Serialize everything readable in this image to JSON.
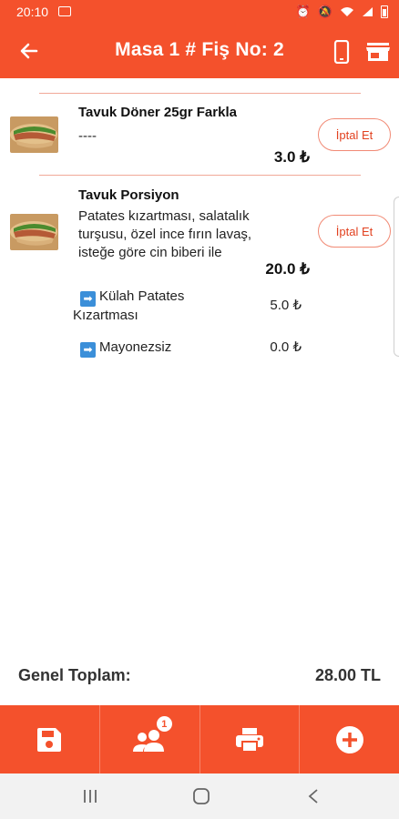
{
  "status_bar": {
    "time": "20:10",
    "signal_text": "⚡ ◠ ▂▄▆ "
  },
  "header": {
    "title": "Masa 1 # Fiş No: 2"
  },
  "items": [
    {
      "name": "Tavuk Döner 25gr Farkla",
      "description": "----",
      "price": "3.0 ₺",
      "cancel_label": "İptal Et",
      "options": []
    },
    {
      "name": "Tavuk Porsiyon",
      "description": "Patates kızartması, salatalık turşusu, özel ince fırın lavaş, isteğe göre cin biberi ile",
      "price": "20.0 ₺",
      "cancel_label": "İptal Et",
      "options": [
        {
          "arrow": "➡",
          "line1": "Külah Patates",
          "line2": "Kızartması",
          "price": "5.0 ₺"
        },
        {
          "arrow": "➡",
          "line1": "Mayonezsiz",
          "line2": "",
          "price": "0.0 ₺"
        }
      ]
    }
  ],
  "total": {
    "label": "Genel Toplam:",
    "value": "28.00 TL"
  },
  "bottom_bar": {
    "customer_badge": "1"
  },
  "colors": {
    "accent": "#f4512c",
    "cancel_text": "#e2411f",
    "separator": "#f1a898"
  }
}
